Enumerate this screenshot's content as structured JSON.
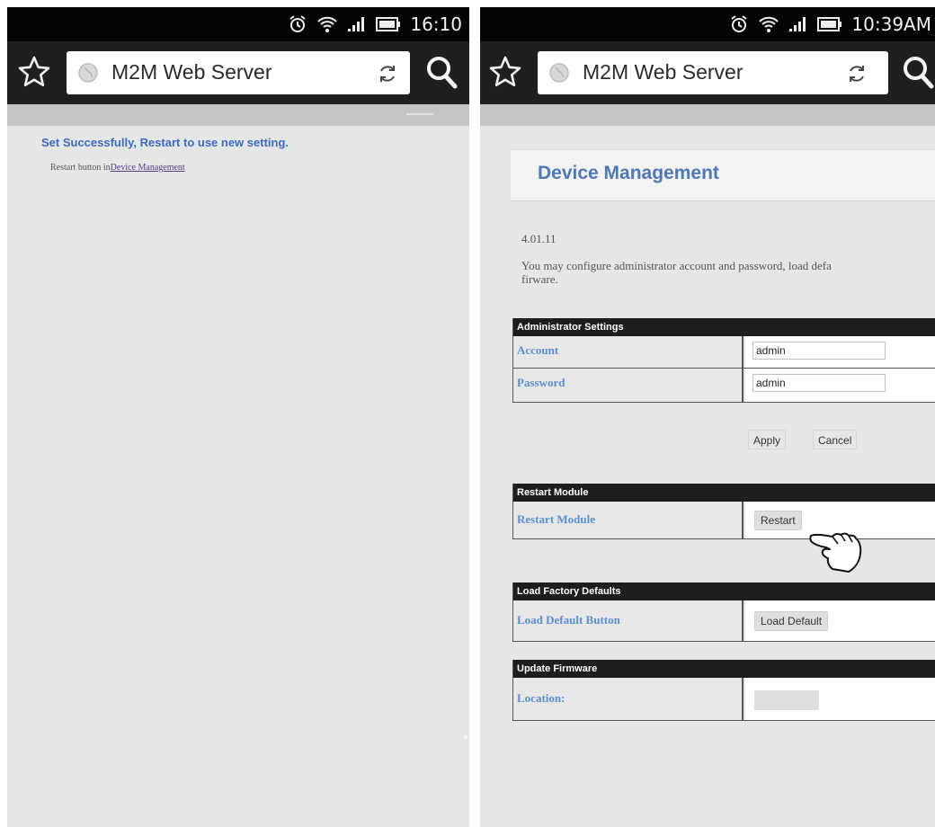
{
  "left_screen": {
    "status_time": "16:10",
    "url_title": "M2M Web Server",
    "success_message": "Set Successfully, Restart to use new setting.",
    "restart_prefix": "Restart button in",
    "restart_link": "Device Management"
  },
  "right_screen": {
    "status_time": "10:39AM",
    "url_title": "M2M Web Server",
    "page_title": "Device Management",
    "version": "4.01.11",
    "description_line1": "You may configure administrator account and password, load defa",
    "description_line2": "firware.",
    "admin_section": {
      "header": "Administrator Settings",
      "account_label": "Account",
      "account_value": "admin",
      "password_label": "Password",
      "password_value": "admin",
      "apply_label": "Apply",
      "cancel_label": "Cancel"
    },
    "restart_section": {
      "header": "Restart Module",
      "label": "Restart Module",
      "button_label": "Restart"
    },
    "factory_section": {
      "header": "Load Factory Defaults",
      "label": "Load Default Button",
      "button_label": "Load Default"
    },
    "firmware_section": {
      "header": "Update Firmware",
      "label": "Location:"
    }
  },
  "colors": {
    "toolbar_bg": "#1f1f21",
    "page_bg": "#e5e7e6",
    "link_blue": "#3b6cc2",
    "label_blue": "#5b8fd0",
    "section_header_bg": "#1e1e1e"
  }
}
